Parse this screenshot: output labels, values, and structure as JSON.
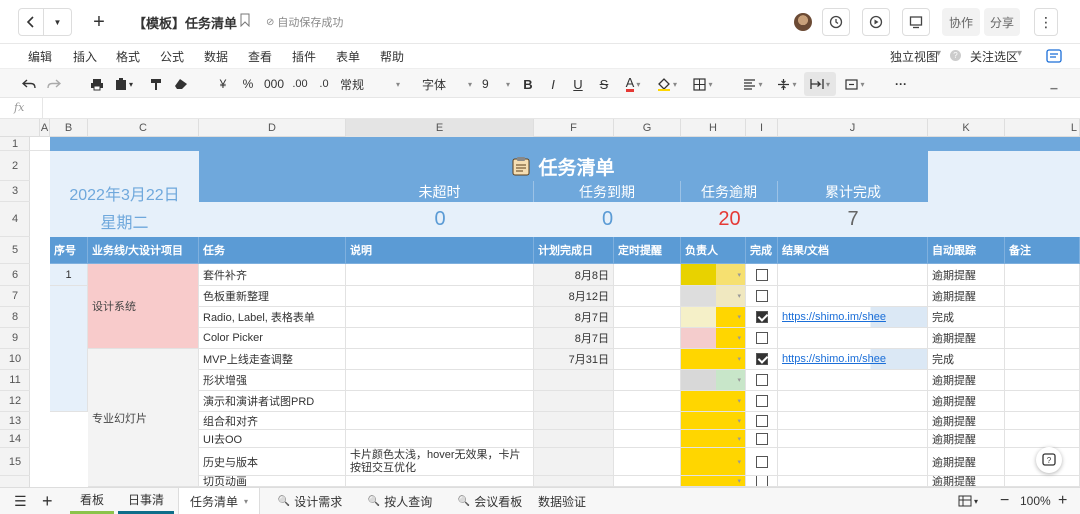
{
  "titlebar": {
    "doc_title": "【模板】任务清单",
    "autosave": "自动保存成功",
    "collab": "协作",
    "share": "分享"
  },
  "menu": [
    "编辑",
    "插入",
    "格式",
    "公式",
    "数据",
    "查看",
    "插件",
    "表单",
    "帮助"
  ],
  "menu_right": {
    "view": "独立视图",
    "follow": "关注选区"
  },
  "toolbar": {
    "currency": "¥",
    "percent": "%",
    "thousand": "000",
    "dec_add": ".00",
    "dec_sub": ".0",
    "format": "常规",
    "font": "字体",
    "size": "9",
    "bold": "B",
    "italic": "I",
    "underline": "U",
    "strike": "S",
    "fontcolor": "A",
    "more": "···"
  },
  "fx": "fx",
  "columns": [
    "A",
    "B",
    "C",
    "D",
    "E",
    "F",
    "G",
    "H",
    "I",
    "J",
    "K",
    "L"
  ],
  "rows": [
    "1",
    "2",
    "3",
    "4",
    "5",
    "6",
    "7",
    "8",
    "9",
    "10",
    "11",
    "12",
    "13",
    "14",
    "15"
  ],
  "banner": {
    "title": "任务清单",
    "date": "2022年3月22日",
    "weekday": "星期二"
  },
  "stats": [
    {
      "label": "未超时",
      "value": "0"
    },
    {
      "label": "任务到期",
      "value": "0"
    },
    {
      "label": "任务逾期",
      "value": "20"
    },
    {
      "label": "累计完成",
      "value": "7"
    }
  ],
  "headers": {
    "seq": "序号",
    "project": "业务线/大设计项目",
    "task": "任务",
    "desc": "说明",
    "due": "计划完成日",
    "remind": "定时提醒",
    "owner": "负责人",
    "done": "完成",
    "result": "结果/文档",
    "auto": "自动跟踪",
    "note": "备注"
  },
  "groups": [
    {
      "name": "设计系统",
      "seq": "1"
    },
    {
      "name": "专业幻灯片"
    }
  ],
  "tasks": [
    {
      "task": "套件补齐",
      "desc": "",
      "due": "8月8日",
      "done": false,
      "result": "",
      "auto": "逾期提醒"
    },
    {
      "task": "色板重新整理",
      "desc": "",
      "due": "8月12日",
      "done": false,
      "result": "",
      "auto": "逾期提醒"
    },
    {
      "task": "Radio, Label, 表格表单",
      "desc": "",
      "due": "8月7日",
      "done": true,
      "result": "https://shimo.im/shee",
      "auto": "完成"
    },
    {
      "task": "Color Picker",
      "desc": "",
      "due": "8月7日",
      "done": false,
      "result": "",
      "auto": "逾期提醒"
    },
    {
      "task": "MVP上线走查调整",
      "desc": "",
      "due": "7月31日",
      "done": true,
      "result": "https://shimo.im/shee",
      "auto": "完成"
    },
    {
      "task": "形状增强",
      "desc": "",
      "due": "",
      "done": false,
      "result": "",
      "auto": "逾期提醒"
    },
    {
      "task": "演示和演讲者试图PRD",
      "desc": "",
      "due": "",
      "done": false,
      "result": "",
      "auto": "逾期提醒"
    },
    {
      "task": "组合和对齐",
      "desc": "",
      "due": "",
      "done": false,
      "result": "",
      "auto": "逾期提醒"
    },
    {
      "task": "UI去OO",
      "desc": "",
      "due": "",
      "done": false,
      "result": "",
      "auto": "逾期提醒"
    },
    {
      "task": "历史与版本",
      "desc": "卡片颜色太浅，hover无效果，卡片按钮交互优化",
      "due": "",
      "done": false,
      "result": "",
      "auto": "逾期提醒"
    },
    {
      "task": "切页动画",
      "desc": "",
      "due": "",
      "done": false,
      "result": "",
      "auto": "逾期提醒"
    }
  ],
  "sheets": [
    {
      "label": "看板",
      "type": "plain"
    },
    {
      "label": "日事清",
      "type": "plain"
    },
    {
      "label": "任务清单",
      "type": "active"
    },
    {
      "label": "设计需求",
      "type": "search"
    },
    {
      "label": "按人查询",
      "type": "search"
    },
    {
      "label": "会议看板",
      "type": "search"
    },
    {
      "label": "数据验证",
      "type": "plain"
    }
  ],
  "zoom": "100%",
  "colors": {
    "header_blue": "#5b9bd5",
    "overdue_red": "#e53935",
    "group_pink": "#f8cbcb",
    "owner_yellow": "#ffd600"
  }
}
